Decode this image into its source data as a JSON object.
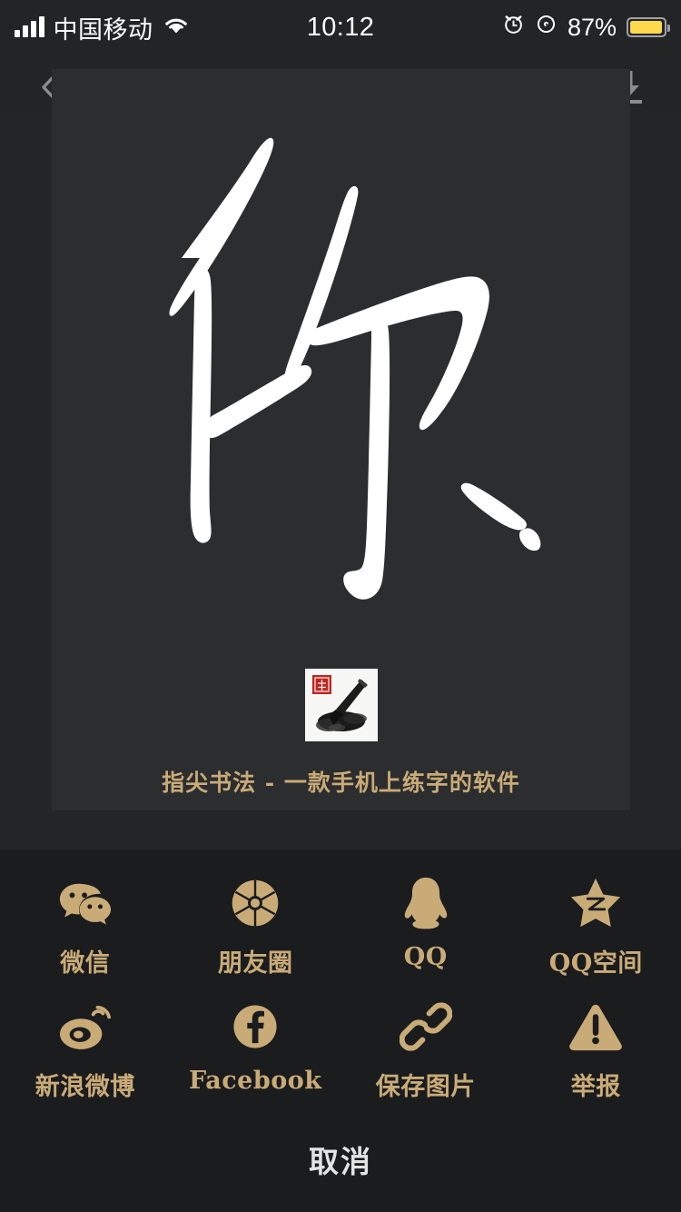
{
  "status_bar": {
    "carrier": "中国移动",
    "time": "10:12",
    "battery_text": "87%",
    "battery_level": 87,
    "battery_color": "#ffd84d",
    "icons": [
      "signal-bars-icon",
      "wifi-icon",
      "alarm-clock-icon",
      "rotation-lock-icon",
      "battery-icon"
    ]
  },
  "nav_bar": {
    "back_icon": "chevron-left-icon",
    "save_icon": "download-icon"
  },
  "preview": {
    "character": "你",
    "character_style": "white cursive brush calligraphy on dark card",
    "logo_icon": "ink-brush-seal-logo",
    "logo_seal_color": "#c0241f",
    "caption": "指尖书法 - 一款手机上练字的软件",
    "caption_color": "#c9ab77",
    "card_color": "#2b2d2f"
  },
  "share_sheet": {
    "accent_color": "#c9ab77",
    "background_color": "#1a1c1e",
    "items": [
      {
        "label": "微信",
        "icon": "wechat-icon"
      },
      {
        "label": "朋友圈",
        "icon": "moments-aperture-icon"
      },
      {
        "label": "QQ",
        "icon": "qq-penguin-icon"
      },
      {
        "label": "QQ空间",
        "icon": "qzone-star-icon"
      },
      {
        "label": "新浪微博",
        "icon": "weibo-eye-icon"
      },
      {
        "label": "Facebook",
        "icon": "facebook-icon"
      },
      {
        "label": "保存图片",
        "icon": "chain-link-icon"
      },
      {
        "label": "举报",
        "icon": "warning-triangle-icon"
      }
    ],
    "cancel_label": "取消",
    "cancel_color": "#e3e3e3"
  }
}
